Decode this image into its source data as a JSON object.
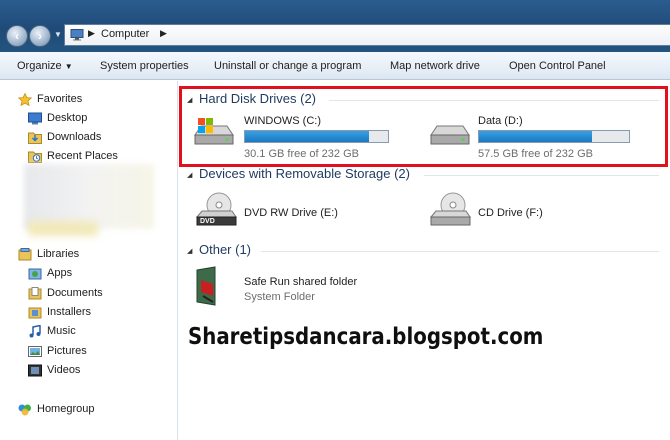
{
  "address": {
    "path": "Computer"
  },
  "toolbar": {
    "items": [
      "Organize",
      "System properties",
      "Uninstall or change a program",
      "Map network drive",
      "Open Control Panel"
    ]
  },
  "sidebar": {
    "favorites": {
      "label": "Favorites",
      "items": [
        "Desktop",
        "Downloads",
        "Recent Places"
      ]
    },
    "libraries": {
      "label": "Libraries",
      "items": [
        "Apps",
        "Documents",
        "Installers",
        "Music",
        "Pictures",
        "Videos"
      ]
    },
    "homegroup": {
      "label": "Homegroup"
    }
  },
  "groups": {
    "hdd": {
      "title": "Hard Disk Drives (2)"
    },
    "removable": {
      "title": "Devices with Removable Storage (2)"
    },
    "other": {
      "title": "Other (1)"
    }
  },
  "drives": [
    {
      "name": "WINDOWS (C:)",
      "free_text": "30.1 GB free of 232 GB",
      "used_fraction": 0.87
    },
    {
      "name": "Data (D:)",
      "free_text": "57.5 GB free of 232 GB",
      "used_fraction": 0.75
    }
  ],
  "removable": [
    {
      "name": "DVD RW Drive (E:)",
      "icon_text": "DVD"
    },
    {
      "name": "CD Drive (F:)"
    }
  ],
  "other_items": [
    {
      "name": "Safe Run shared folder",
      "type": "System Folder"
    }
  ],
  "watermark": "Sharetipsdancara.blogspot.com",
  "colors": {
    "highlight": "#e0101e",
    "bar_fill": "#1a78c4"
  }
}
